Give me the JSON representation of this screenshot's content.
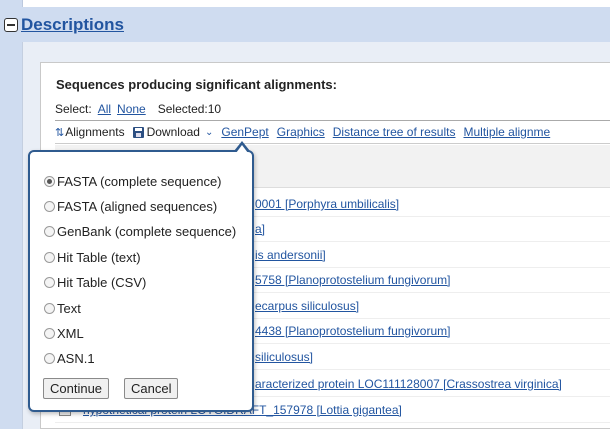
{
  "section": {
    "title": "Descriptions"
  },
  "results": {
    "heading": "Sequences producing significant alignments:",
    "select_label": "Select:",
    "all_link": "All",
    "none_link": "None",
    "selected": "Selected:10"
  },
  "toolbar": {
    "alignments": "Alignments",
    "download": "Download",
    "genpept": "GenPept",
    "graphics": "Graphics",
    "distance_tree": "Distance tree of results",
    "multiple_alignment": "Multiple alignme"
  },
  "rows": [
    "0001 [Porphyra umbilicalis]",
    "a]",
    "is andersonii]",
    "5758 [Planoprotostelium fungivorum]",
    "ecarpus siliculosus]",
    "4438 [Planoprotostelium fungivorum]",
    "siliculosus]",
    "aracterized protein LOC111128007 [Crassostrea virginica]",
    "hypothetical protein LOTGIDRAFT_157978 [Lottia gigantea]"
  ],
  "download_popup": {
    "options": [
      "FASTA (complete sequence)",
      "FASTA (aligned sequences)",
      "GenBank (complete sequence)",
      "Hit Table (text)",
      "Hit Table (CSV)",
      "Text",
      "XML",
      "ASN.1"
    ],
    "selected_index": 0,
    "continue_label": "Continue",
    "cancel_label": "Cancel"
  },
  "colors": {
    "link": "#2255a0",
    "popup_border": "#2f5b8f",
    "page_bg": "#cfdcf0"
  }
}
